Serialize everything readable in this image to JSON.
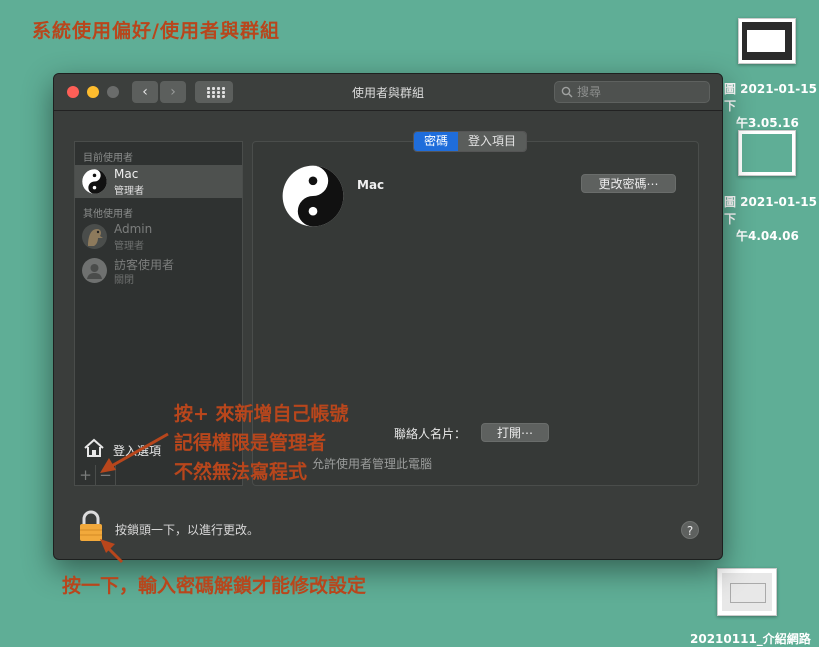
{
  "annotations": {
    "title": "系統使用偏好/使用者與群組",
    "add_user_note": [
      "按+ 來新增自己帳號",
      "記得權限是管理者",
      "不然無法寫程式"
    ],
    "lock_note": "按一下，輸入密碼解鎖才能修改設定"
  },
  "desktop_files": [
    {
      "name_line1": "圖 2021-01-15 下",
      "name_line2": "午3.05.16"
    },
    {
      "name_line1": "圖 2021-01-15 下",
      "name_line2": "午4.04.06"
    },
    {
      "name_line1": "20210111_介紹網路"
    }
  ],
  "window": {
    "title": "使用者與群組",
    "search_placeholder": "搜尋",
    "nav_back": "‹",
    "nav_forward": "›"
  },
  "sidebar": {
    "current_users_header": "目前使用者",
    "other_users_header": "其他使用者",
    "current_user": {
      "name": "Mac",
      "role": "管理者"
    },
    "other_users": [
      {
        "name": "Admin",
        "role": "管理者"
      },
      {
        "name": "訪客使用者",
        "role": "關閉"
      }
    ],
    "login_options_label": "登入選項",
    "add_button": "+",
    "remove_button": "−"
  },
  "main": {
    "tabs": [
      {
        "label": "密碼",
        "active": true
      },
      {
        "label": "登入項目",
        "active": false
      }
    ],
    "user_name": "Mac",
    "change_password_button": "更改密碼⋯",
    "contact_card_label": "聯絡人名片：",
    "open_button": "打開⋯",
    "allow_admin_text": "允許使用者管理此電腦"
  },
  "footer": {
    "lock_text": "按鎖頭一下，以進行更改。",
    "help_button": "?"
  },
  "colors": {
    "desktop": "#5fae96",
    "annotation": "#b8461c",
    "accent": "#1f6ddb",
    "lock": "#f2a93b"
  }
}
